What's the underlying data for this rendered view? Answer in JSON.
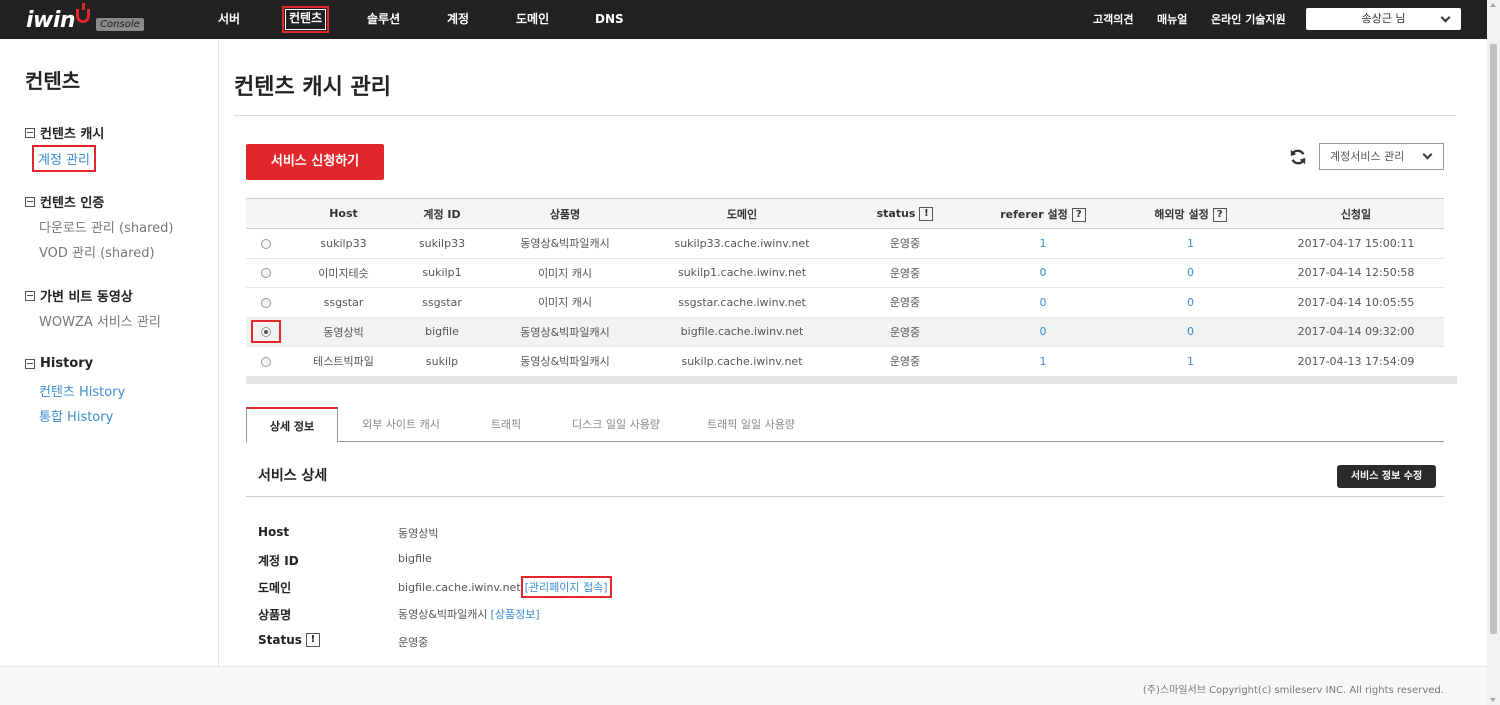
{
  "brand": {
    "logo": "iwin",
    "console_badge": "Console"
  },
  "nav": {
    "items": [
      "서버",
      "컨텐츠",
      "솔루션",
      "계정",
      "도메인",
      "DNS"
    ],
    "active": "컨텐츠",
    "util": [
      "고객의견",
      "매뉴얼",
      "온라인 기술지원"
    ],
    "user": "송상근 님"
  },
  "sidebar": {
    "title": "컨텐츠",
    "groups": [
      {
        "label": "컨텐츠 캐시",
        "links": [
          "계정 관리"
        ]
      },
      {
        "label": "컨텐츠 인증",
        "links": [
          "다운로드 관리 (shared)",
          "VOD 관리 (shared)"
        ]
      },
      {
        "label": "가변 비트 동영상",
        "links": [
          "WOWZA 서비스 관리"
        ]
      },
      {
        "label": "History",
        "links": [
          "컨텐츠 History",
          "통합 History"
        ]
      }
    ]
  },
  "main": {
    "title": "컨텐츠 캐시 관리",
    "apply_button": "서비스 신청하기",
    "service_select": "계정서비스 관리",
    "table": {
      "headers": [
        "Host",
        "계정 ID",
        "상품명",
        "도메인",
        "status",
        "referer 설정",
        "해외망 설정",
        "신청일"
      ],
      "help_mark": "?",
      "status_mark": "!",
      "rows": [
        [
          "sukilp33",
          "sukilp33",
          "동영상&빅파일캐시",
          "sukilp33.cache.iwinv.net",
          "운영중",
          "1",
          "1",
          "2017-04-17 15:00:11"
        ],
        [
          "이미지테슷",
          "sukilp1",
          "이미지 캐시",
          "sukilp1.cache.iwinv.net",
          "운영중",
          "0",
          "0",
          "2017-04-14 12:50:58"
        ],
        [
          "ssgstar",
          "ssgstar",
          "이미지 캐시",
          "ssgstar.cache.iwinv.net",
          "운영중",
          "0",
          "0",
          "2017-04-14 10:05:55"
        ],
        [
          "동영상빅",
          "bigfile",
          "동영상&빅파일캐시",
          "bigfile.cache.iwinv.net",
          "운영중",
          "0",
          "0",
          "2017-04-14 09:32:00"
        ],
        [
          "테스트빅파일",
          "sukilp",
          "동영상&빅파일캐시",
          "sukilp.cache.iwinv.net",
          "운영중",
          "1",
          "1",
          "2017-04-13 17:54:09"
        ]
      ],
      "selected_row": 3
    },
    "tabs": [
      "상세 정보",
      "외부 사이트 캐시",
      "트래픽",
      "디스크 일일 사용량",
      "트래픽 일일 사용량"
    ],
    "detail": {
      "section_title": "서비스 상세",
      "edit_button": "서비스 정보 수정",
      "host_label": "Host",
      "host_value": "동영상빅",
      "account_label": "계정 ID",
      "account_value": "bigfile",
      "domain_label": "도메인",
      "domain_value": "bigfile.cache.iwinv.net",
      "domain_link": "[관리페이지 접속]",
      "product_label": "상품명",
      "product_value": "동영상&빅파일캐시",
      "product_link": "[상품정보]",
      "status_label": "Status",
      "status_value": "운영중",
      "status_mark": "!"
    }
  },
  "footer": "(주)스마일서브 Copyright(c) smileserv INC. All rights reserved.",
  "colors": {
    "accent": "#e1262c",
    "link": "#3b8ed6",
    "topbar": "#222222"
  }
}
